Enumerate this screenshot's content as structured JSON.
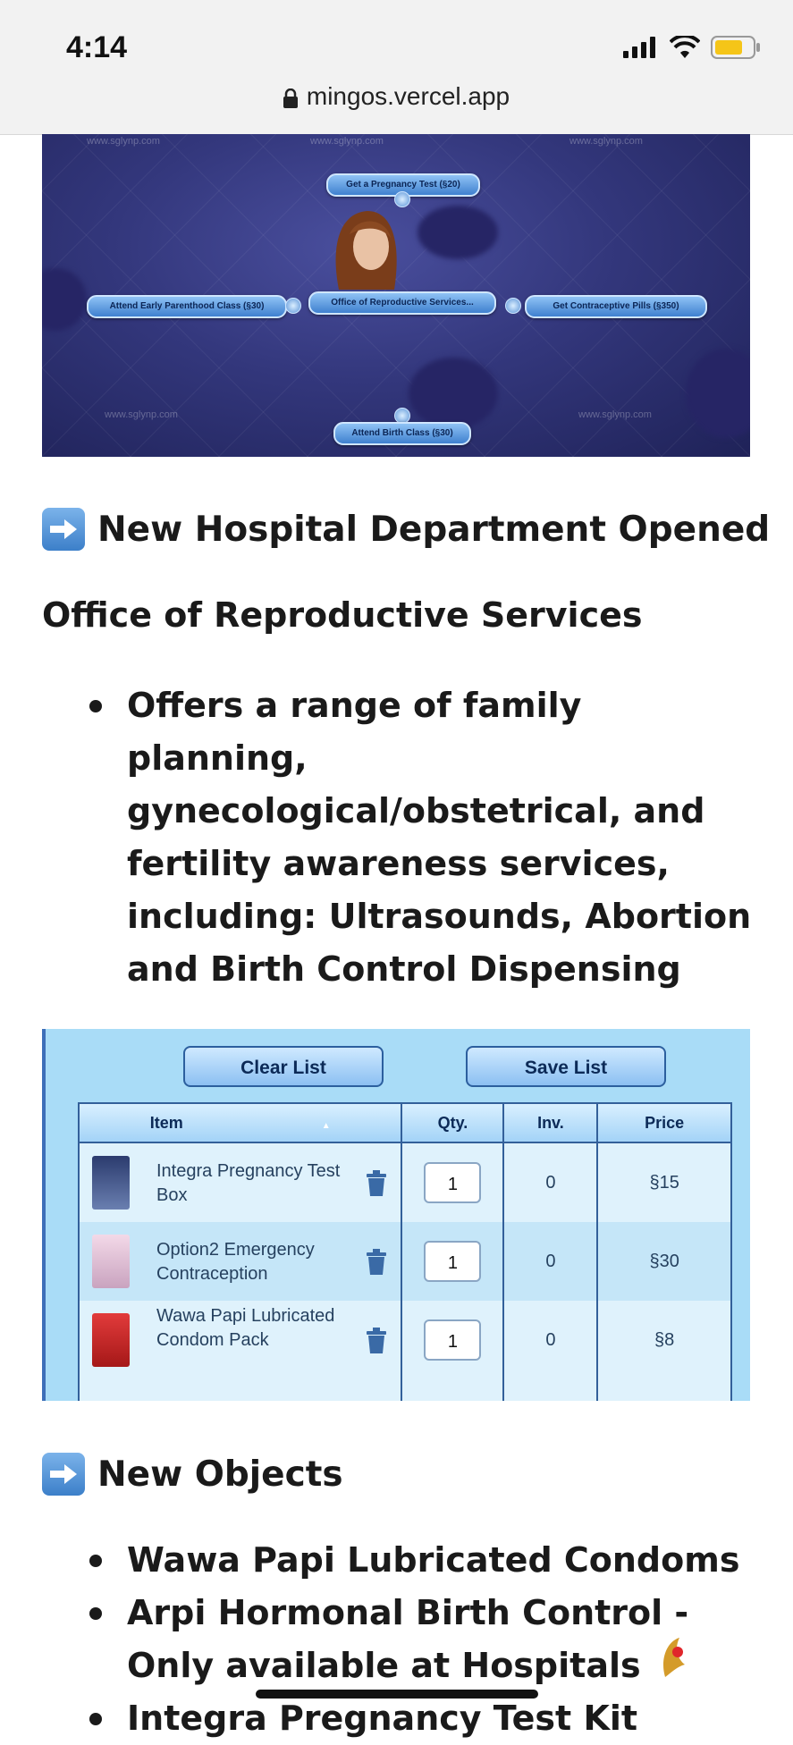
{
  "status_bar": {
    "time": "4:14"
  },
  "browser": {
    "url": "mingos.vercel.app"
  },
  "game_menu": {
    "watermark": "www.sglynp.com",
    "options": [
      "Get a Pregnancy Test (§20)",
      "Attend Early Parenthood Class (§30)",
      "Office of Reproductive Services...",
      "Get Contraceptive Pills (§350)",
      "Attend Birth Class (§30)"
    ]
  },
  "section1": {
    "heading": "New Hospital Department Opened"
  },
  "department": {
    "title": "Office of Reproductive Services",
    "bullets": [
      "Offers a range of family planning, gynecological/obstetrical, and fertility awareness services, including: Ultrasounds, Abortion and Birth Control Dispensing"
    ]
  },
  "shopping_list": {
    "clear_label": "Clear List",
    "save_label": "Save List",
    "columns": [
      "Item",
      "Qty.",
      "Inv.",
      "Price"
    ],
    "rows": [
      {
        "item": "Integra Pregnancy Test Box",
        "qty": "1",
        "inv": "0",
        "price": "§15"
      },
      {
        "item": "Option2 Emergency Contraception",
        "qty": "1",
        "inv": "0",
        "price": "§30"
      },
      {
        "item": "Wawa Papi Lubricated Condom Pack",
        "qty": "1",
        "inv": "0",
        "price": "§8"
      }
    ]
  },
  "section2": {
    "heading": "New Objects",
    "bullets": [
      "Wawa Papi Lubricated Condoms",
      "Arpi Hormonal Birth Control - Only available at Hospitals",
      "Integra Pregnancy Test Kit"
    ]
  },
  "colors": {
    "accent_blue": "#3c7fc9",
    "panel_blue": "#a9dcf7"
  },
  "icons": [
    "lock-icon",
    "signal-icon",
    "wifi-icon",
    "battery-icon",
    "arrow-right-icon",
    "trash-icon"
  ]
}
